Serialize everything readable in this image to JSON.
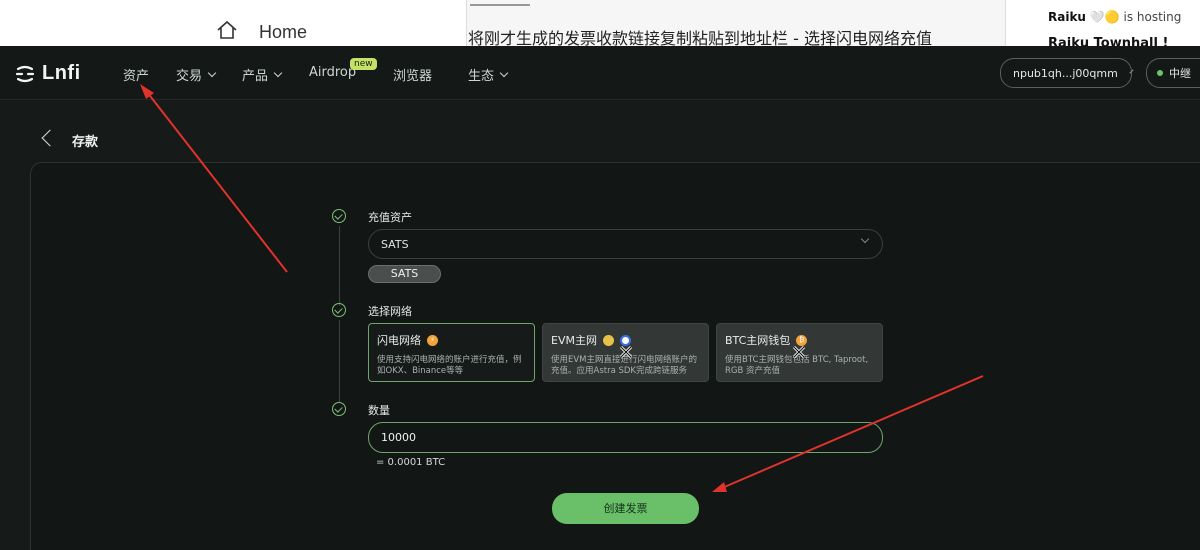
{
  "top_strip": {
    "home_label": "Home",
    "instruction": "将刚才生成的发票收款链接复制粘贴到地址栏 - 选择闪电网络充值",
    "side_author": "Raiku",
    "side_author_suffix": "is hosting",
    "side_title": "Raiku Townhall !"
  },
  "nav": {
    "logo_text": "Lnfi",
    "items": [
      "资产",
      "交易",
      "产品",
      "Airdrop",
      "浏览器",
      "生态"
    ],
    "badge_new": "new",
    "wallet": "npub1qh...j00qmm",
    "network": "中继"
  },
  "page": {
    "title": "存款"
  },
  "form": {
    "step1_label": "充值资产",
    "asset_value": "SATS",
    "asset_chip": "SATS",
    "step2_label": "选择网络",
    "networks": [
      {
        "title": "闪电网络",
        "desc": "使用支持闪电网络的账户进行充值，例如OKX、Binance等等"
      },
      {
        "title": "EVM主网",
        "desc": "使用EVM主网直接进行闪电网络账户的充值。应用Astra SDK完成跨链服务"
      },
      {
        "title": "BTC主网钱包",
        "desc": "使用BTC主网钱包包括 BTC, Taproot, RGB 资产充值"
      }
    ],
    "step3_label": "数量",
    "amount_value": "10000",
    "amount_note": "= 0.0001 BTC",
    "submit_label": "创建发票"
  },
  "colors": {
    "accent_green": "#6abf69",
    "annotation_red": "#e0332b",
    "badge_new": "#c6e264"
  }
}
